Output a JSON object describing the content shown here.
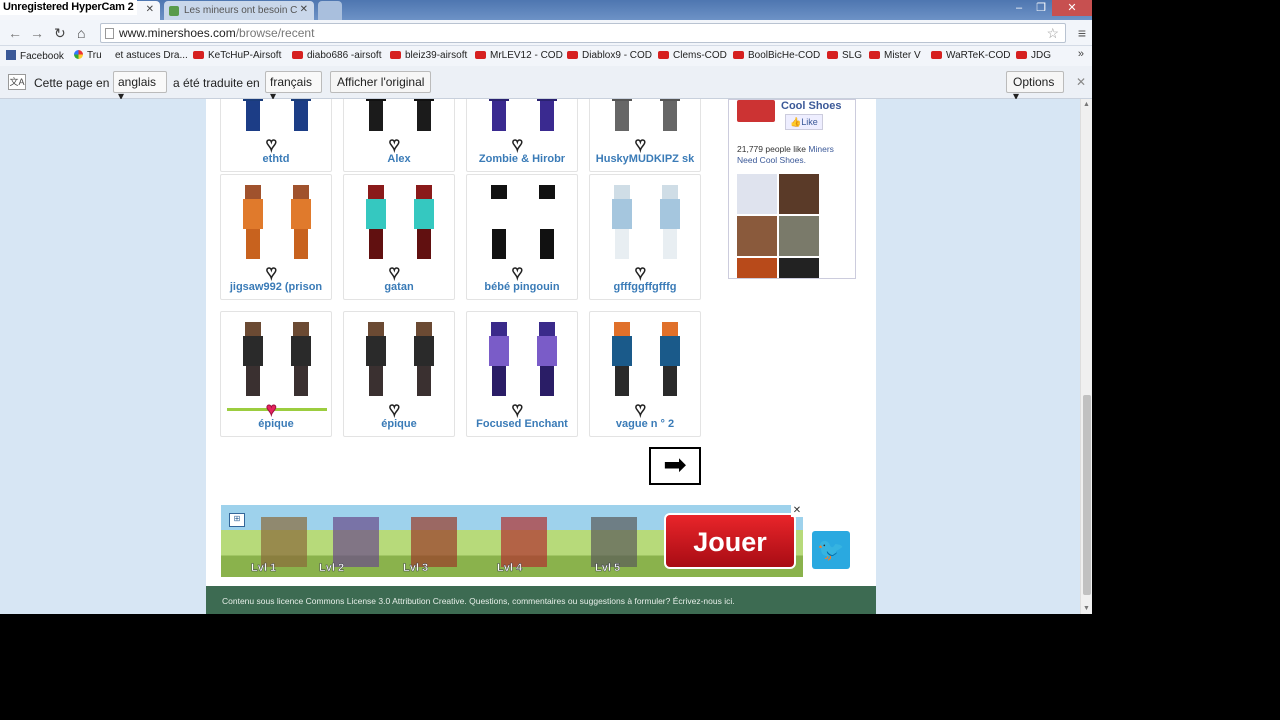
{
  "recorder_watermark": "Unregistered HyperCam 2",
  "tabs": [
    {
      "label": "Unregistered HyperCam 2",
      "active": true
    },
    {
      "label": "Les mineurs ont besoin C",
      "active": false
    }
  ],
  "address": {
    "domain": "www.minershoes.com",
    "path": "/browse/recent"
  },
  "bookmarks": [
    {
      "label": "Facebook",
      "icon": "facebook-icon"
    },
    {
      "label": "Tru",
      "icon": "google-icon"
    },
    {
      "label": "et astuces Dra...",
      "icon": "none"
    },
    {
      "label": "KeTcHuP-Airsoft",
      "icon": "youtube-icon"
    },
    {
      "label": "diabo686 -airsoft",
      "icon": "youtube-icon"
    },
    {
      "label": "bleiz39-airsoft",
      "icon": "youtube-icon"
    },
    {
      "label": "MrLEV12 - COD",
      "icon": "youtube-icon"
    },
    {
      "label": "Diablox9 - COD",
      "icon": "youtube-icon"
    },
    {
      "label": "Clems-COD",
      "icon": "youtube-icon"
    },
    {
      "label": "BoolBicHe-COD",
      "icon": "youtube-icon"
    },
    {
      "label": "SLG",
      "icon": "youtube-icon"
    },
    {
      "label": "Mister V",
      "icon": "youtube-icon"
    },
    {
      "label": "WaRTeK-COD",
      "icon": "youtube-icon"
    },
    {
      "label": "JDG",
      "icon": "youtube-icon"
    }
  ],
  "translate_bar": {
    "text_before": "Cette page en",
    "source_lang": "anglais",
    "text_middle": "a été traduite en",
    "target_lang": "français",
    "show_original": "Afficher l'original",
    "options": "Options"
  },
  "skins": [
    {
      "name": "ethtd",
      "liked": false,
      "colors": [
        "#2860b8",
        "#1a3c7a",
        "#1c3d86"
      ]
    },
    {
      "name": "Alex",
      "liked": false,
      "colors": [
        "#222",
        "#111",
        "#1b1b1b"
      ]
    },
    {
      "name": "Zombie & Hirobr",
      "liked": false,
      "colors": [
        "#5a3ab8",
        "#2a2270",
        "#3a2a90"
      ]
    },
    {
      "name": "HuskyMUDKIPZ sk",
      "liked": false,
      "colors": [
        "#777",
        "#555",
        "#666"
      ]
    },
    {
      "name": "jigsaw992 (prison",
      "liked": false,
      "colors": [
        "#a0522d",
        "#e07a2c",
        "#c8621e"
      ]
    },
    {
      "name": "gatan",
      "liked": false,
      "colors": [
        "#8a1a1a",
        "#35c8c0",
        "#611010"
      ]
    },
    {
      "name": "bébé pingouin",
      "liked": false,
      "colors": [
        "#111",
        "#fff",
        "#111"
      ]
    },
    {
      "name": "gfffggffgfffg",
      "liked": false,
      "colors": [
        "#cfdde6",
        "#a5c6de",
        "#e8eef2"
      ]
    },
    {
      "name": "épique",
      "liked": true,
      "colors": [
        "#6b4a33",
        "#2a2a2a",
        "#3a3030"
      ]
    },
    {
      "name": "épique",
      "liked": false,
      "colors": [
        "#6b4a33",
        "#2a2a2a",
        "#3a3030"
      ]
    },
    {
      "name": "Focused Enchant",
      "liked": false,
      "colors": [
        "#3a2a8a",
        "#7a5cc8",
        "#2a1d66"
      ]
    },
    {
      "name": "vague n ° 2",
      "liked": false,
      "colors": [
        "#e0702a",
        "#1a5a8a",
        "#2a2a2a"
      ]
    }
  ],
  "facebook_widget": {
    "page_name": "Cool Shoes",
    "like_label": "Like",
    "count_text": "21,779 people like",
    "count_link": "Miners Need Cool Shoes."
  },
  "ad": {
    "cta": "Jouer",
    "levels": [
      "Lvl 1",
      "Lvl 2",
      "Lvl 3",
      "Lvl 4",
      "Lvl 5"
    ]
  },
  "footer": "Contenu sous licence Commons License 3.0 Attribution Creative. Questions, commentaires ou suggestions à formuler? Écrivez-nous ici."
}
